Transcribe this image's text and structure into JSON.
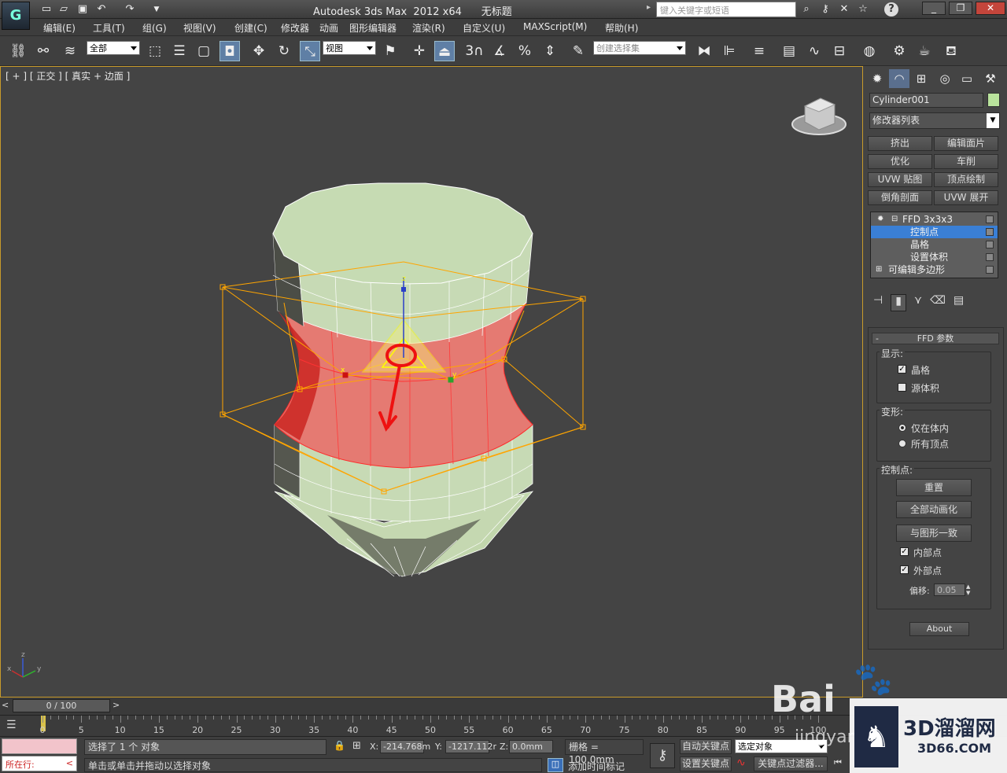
{
  "app": {
    "title": "Autodesk 3ds Max  2012 x64",
    "doc_title": "无标题",
    "logo": "G"
  },
  "search": {
    "placeholder": "键入关键字或短语"
  },
  "menus": [
    "编辑(E)",
    "工具(T)",
    "组(G)",
    "视图(V)",
    "创建(C)",
    "修改器",
    "动画",
    "图形编辑器",
    "渲染(R)",
    "自定义(U)",
    "MAXScript(M)",
    "帮助(H)"
  ],
  "toolbar": {
    "filter_value": "全部",
    "refcoord_value": "视图",
    "snap_num": "3",
    "selset_placeholder": "创建选择集"
  },
  "viewport": {
    "label": "[ + ] [ 正交 ] [ 真实 + 边面 ]",
    "axis": {
      "x": "x",
      "y": "y",
      "z": "z"
    },
    "gizmo_axis": {
      "x": "x",
      "y": "y",
      "z": "z"
    }
  },
  "panel": {
    "object_name": "Cylinder001",
    "object_color": "#b9e39c",
    "modifier_list": "修改器列表",
    "mod_buttons": [
      "挤出",
      "编辑面片",
      "优化",
      "车削",
      "UVW 贴图",
      "顶点绘制",
      "倒角剖面",
      "UVW 展开"
    ],
    "stack": {
      "ffd": "FFD 3x3x3",
      "sub": [
        "控制点",
        "晶格",
        "设置体积"
      ],
      "base": "可编辑多边形"
    },
    "rollout": {
      "title": "FFD 参数",
      "display_label": "显示:",
      "lattice": "晶格",
      "source_volume": "源体积",
      "deform_label": "变形:",
      "only_in_volume": "仅在体内",
      "all_vertices": "所有顶点",
      "cp_label": "控制点:",
      "reset": "重置",
      "animate_all": "全部动画化",
      "conform": "与图形一致",
      "inside_points": "内部点",
      "outside_points": "外部点",
      "offset_label": "偏移:",
      "offset_value": "0.05",
      "about": "About"
    }
  },
  "time": {
    "counter": "0 / 100",
    "ticks": [
      "0",
      "5",
      "10",
      "15",
      "20",
      "25",
      "30",
      "35",
      "40",
      "45",
      "50",
      "55",
      "60",
      "65",
      "70",
      "75",
      "80",
      "85",
      "90",
      "95",
      "100"
    ]
  },
  "status": {
    "selected": "选择了 1 个 对象",
    "hint": "单击或单击并拖动以选择对象",
    "running": "所在行:",
    "x_label": "X:",
    "x_value": "-214.768m",
    "y_label": "Y:",
    "y_value": "-1217.112r",
    "z_label": "Z:",
    "z_value": "0.0mm",
    "grid": "栅格 = 100.0mm",
    "auto_key": "自动关键点",
    "set_key": "设置关键点",
    "key_mode": "选定对象",
    "add_time_tag": "添加时间标记",
    "key_filters": "关键点过滤器..."
  },
  "watermarks": {
    "baidu": "Bai",
    "baidu_sub": "jingyan",
    "site_cn": "3D溜溜网",
    "site_url": "3D66.COM"
  }
}
